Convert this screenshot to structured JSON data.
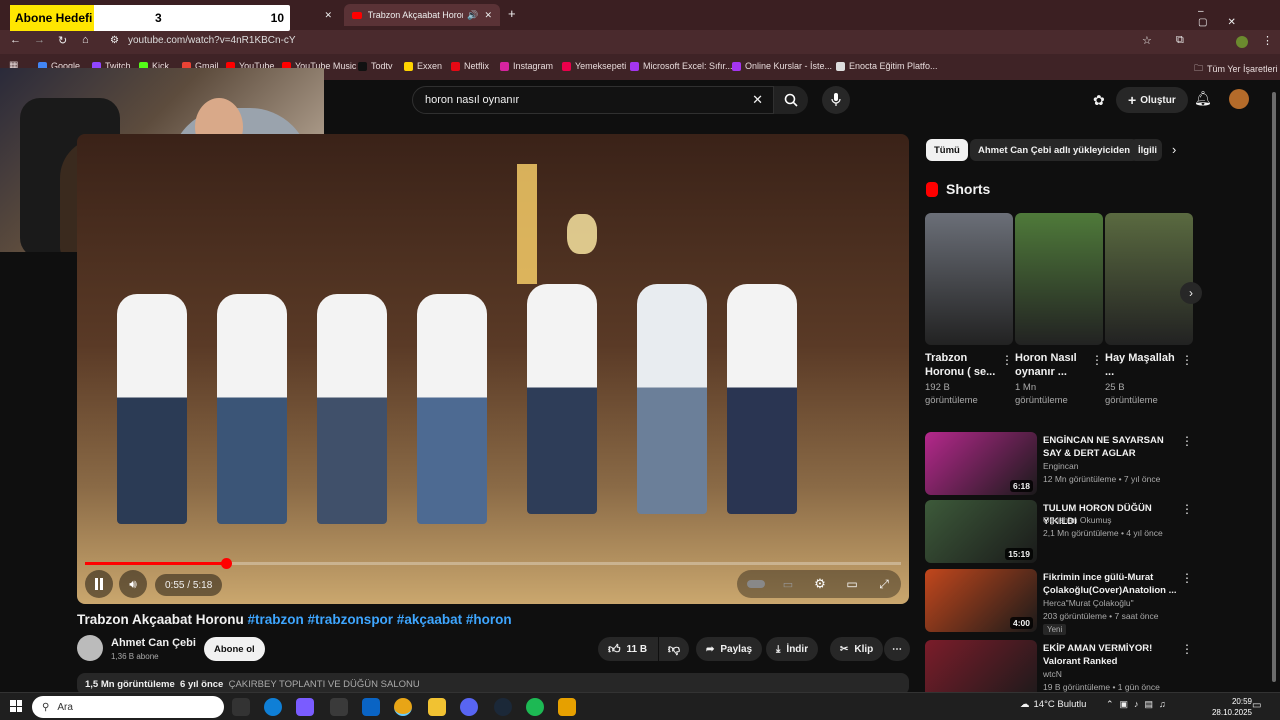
{
  "overlay": {
    "label": "Abone Hedefi",
    "current": "3",
    "target": "10"
  },
  "browser": {
    "tab_title": "Trabzon Akçaabat Horonu",
    "url": "youtube.com/watch?v=4nR1KBCn-cY",
    "bookmarks": [
      {
        "label": "Google",
        "color": "#4285f4"
      },
      {
        "label": "Twitch",
        "color": "#9146ff"
      },
      {
        "label": "Kick",
        "color": "#53fc18"
      },
      {
        "label": "Gmail",
        "color": "#ea4335"
      },
      {
        "label": "YouTube",
        "color": "#ff0000"
      },
      {
        "label": "YouTube Music",
        "color": "#ff0000"
      },
      {
        "label": "Todtv",
        "color": "#111111"
      },
      {
        "label": "Exxen",
        "color": "#ffd400"
      },
      {
        "label": "Netflix",
        "color": "#e50914"
      },
      {
        "label": "Instagram",
        "color": "#d6249f"
      },
      {
        "label": "Yemeksepeti",
        "color": "#ea004b"
      },
      {
        "label": "Microsoft Excel: Sıfır...",
        "color": "#a435f0"
      },
      {
        "label": "Online Kurslar - İste...",
        "color": "#a435f0"
      },
      {
        "label": "Enocta Eğitim Platfo...",
        "color": "#dddddd"
      }
    ],
    "all_bookmarks": "Tüm Yer İşaretleri"
  },
  "youtube": {
    "search_query": "horon nasıl oynanır",
    "create_label": "Oluştur",
    "player": {
      "current_time": "0:55",
      "duration": "5:18",
      "progress": 0.173
    },
    "video_title": "Trabzon Akçaabat Horonu",
    "video_tags": "#trabzon #trabzonspor #akçaabat #horon",
    "channel": {
      "name": "Ahmet Can Çebi",
      "subs": "1,36 B abone"
    },
    "subscribe_label": "Abone ol",
    "likes": "11 B",
    "share_label": "Paylaş",
    "download_label": "İndir",
    "clip_label": "Klip",
    "description": {
      "views": "1,5 Mn görüntüleme",
      "age": "6 yıl önce",
      "text": "ÇAKIRBEY TOPLANTI VE DÜĞÜN SALONU"
    },
    "chips": [
      "Tümü",
      "Ahmet Can Çebi adlı yükleyiciden",
      "İlgili"
    ],
    "shorts_heading": "Shorts",
    "shorts": [
      {
        "title": "Trabzon Horonu ( se...",
        "views": "192 B görüntüleme",
        "color": "#6b6f78"
      },
      {
        "title": "Horon Nasıl oynanır ...",
        "views": "1 Mn görüntüleme",
        "color": "#4f7a3a"
      },
      {
        "title": "Hay Maşallah ...",
        "views": "25 B görüntüleme",
        "color": "#5a6a40"
      }
    ],
    "videos": [
      {
        "title": "ENGİNCAN NE SAYARSAN SAY & DERT AGLAR",
        "channel": "Engincan",
        "meta": "12 Mn görüntüleme • 7 yıl önce",
        "duration": "6:18",
        "color": "#b5288c",
        "badge": ""
      },
      {
        "title": "TULUM HORON DÜĞÜN YIKILDI",
        "channel": "Oğuzhan Okumuş",
        "meta": "2,1 Mn görüntüleme • 4 yıl önce",
        "duration": "15:19",
        "color": "#3d5a3a",
        "badge": ""
      },
      {
        "title": "Fikrimin ince gülü-Murat Çolakoğlu(Cover)Anatolion ...",
        "channel": "Herca\"Murat Çolakoğlu\"",
        "meta": "203 görüntüleme • 7 saat önce",
        "duration": "4:00",
        "color": "#c2471c",
        "badge": "Yeni"
      },
      {
        "title": "EKİP AMAN VERMİYOR! Valorant Ranked",
        "channel": "wtcN",
        "meta": "19 B görüntüleme • 1 gün önce",
        "duration": "",
        "color": "#7b1c2a",
        "badge": ""
      }
    ]
  },
  "taskbar": {
    "search_placeholder": "Ara",
    "weather": "14°C Bulutlu",
    "time": "20:59",
    "date": "28.10.2025"
  }
}
